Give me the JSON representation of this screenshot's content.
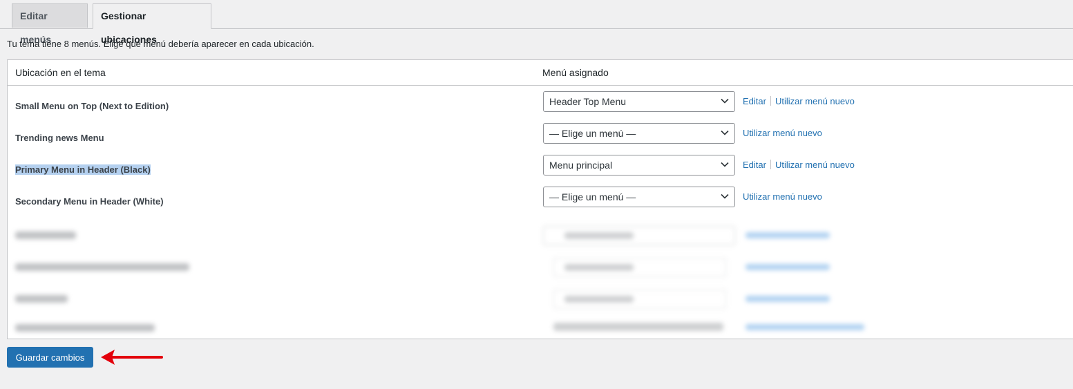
{
  "tabs": {
    "edit": "Editar menús",
    "manage": "Gestionar ubicaciones"
  },
  "intro": "Tu tema tiene 8 menús. Elige qué menú debería aparecer en cada ubicación.",
  "table": {
    "col_location": "Ubicación en el tema",
    "col_menu": "Menú asignado",
    "rows": [
      {
        "location": "Small Menu on Top (Next to Edition)",
        "menu": "Header Top Menu",
        "edit": "Editar",
        "new": "Utilizar menú nuevo"
      },
      {
        "location": "Trending news Menu",
        "menu": "— Elige un menú —",
        "new": "Utilizar menú nuevo"
      },
      {
        "location": "Primary Menu in Header (Black)",
        "menu": "Menu principal",
        "edit": "Editar",
        "new": "Utilizar menú nuevo"
      },
      {
        "location": "Secondary Menu in Header (White)",
        "menu": "— Elige un menú —",
        "new": "Utilizar menú nuevo"
      }
    ]
  },
  "save_label": "Guardar cambios",
  "colors": {
    "accent": "#2271b1",
    "arrow": "#e3000b",
    "selection": "#b4d0ef"
  }
}
